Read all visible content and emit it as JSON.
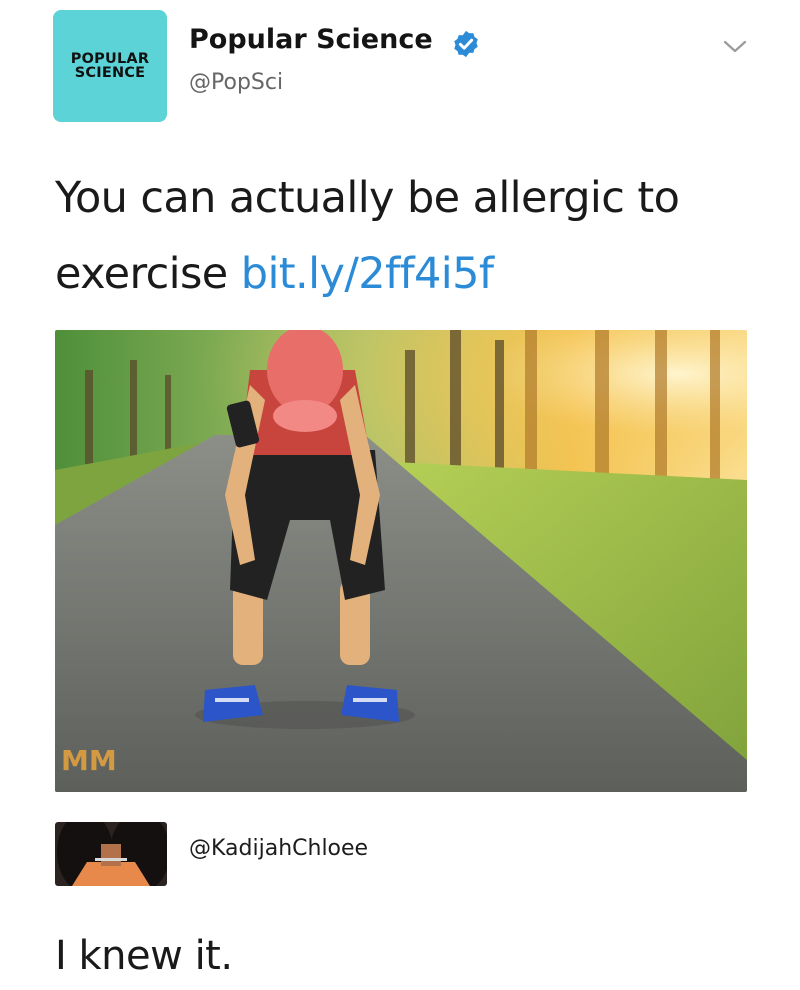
{
  "tweet": {
    "author": {
      "logo_line1": "POPULAR",
      "logo_line2": "SCIENCE",
      "display_name": "Popular Science",
      "handle": "@PopSci",
      "logo_color": "#5cd3d6",
      "verified": true
    },
    "menu_icon": "chevron-down-icon",
    "text": "You can actually be allergic to exercise",
    "link": "bit.ly/2ff4i5f",
    "link_color": "#2b8bd6",
    "photo_watermark": "MM"
  },
  "reply": {
    "handle": "@KadijahChloee",
    "text": "I knew it."
  }
}
